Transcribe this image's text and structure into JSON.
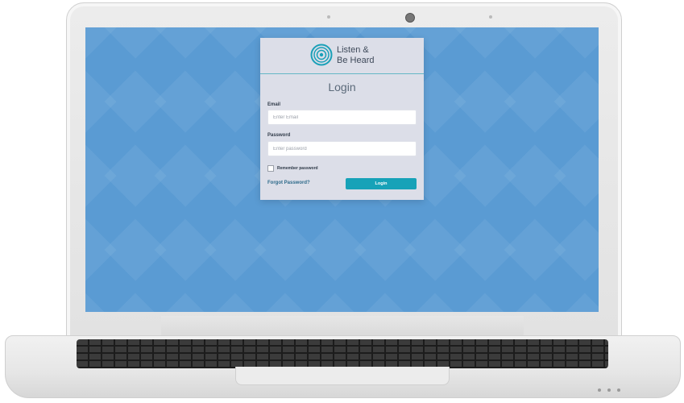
{
  "brand": {
    "line1": "Listen &",
    "line2": "Be Heard"
  },
  "login": {
    "title": "Login"
  },
  "form": {
    "email_label": "Email",
    "email_placeholder": "Enter Email",
    "password_label": "Password",
    "password_placeholder": "Enter password",
    "remember_label": "Remember password",
    "forgot_label": "Forgot Password?",
    "submit_label": "Login"
  },
  "colors": {
    "screen_bg": "#5a9bd3",
    "accent": "#17a2b8",
    "link": "#2d6a8a"
  }
}
